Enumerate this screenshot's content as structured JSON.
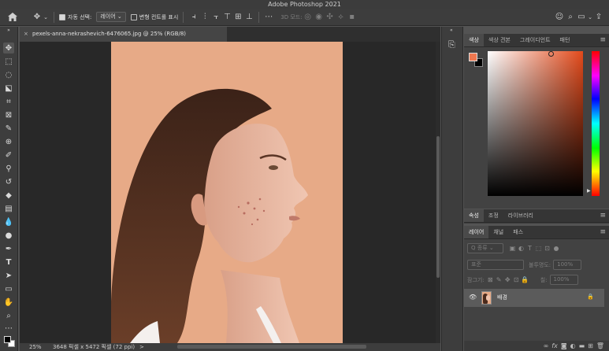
{
  "app": {
    "title": "Adobe Photoshop 2021"
  },
  "options": {
    "auto_select_label": "자동 선택:",
    "auto_select_value": "레이어",
    "transform_controls_label": "변형 컨트롤 표시",
    "mode_3d_label": "3D 모드:"
  },
  "document": {
    "tab_title": "pexels-anna-nekrashevich-6476065.jpg @ 25% (RGB/8)",
    "close_glyph": "×"
  },
  "status": {
    "zoom": "25%",
    "doc_info": "3648 픽셀 x 5472 픽셀 (72 ppi)",
    "arrow": ">"
  },
  "color_panel": {
    "tabs": [
      "색상",
      "색상 견본",
      "그레이디언트",
      "패턴"
    ],
    "foreground_color": "#f07850",
    "background_color": "#000000",
    "hue_color": "#e34a1b"
  },
  "properties_panel": {
    "tabs": [
      "속성",
      "조정",
      "라이브러리"
    ]
  },
  "layers_panel": {
    "tabs": [
      "레이어",
      "채널",
      "패스"
    ],
    "filter_kind": "Q 종류",
    "blend_mode": "표준",
    "opacity_label": "불투명도:",
    "opacity_value": "100%",
    "lock_label": "잠그기:",
    "fill_label": "칠:",
    "fill_value": "100%",
    "layers": [
      {
        "name": "배경",
        "visible": true,
        "locked": true
      }
    ]
  },
  "icons": {
    "home": "home-icon",
    "move": "move-icon",
    "search": "search-icon",
    "share": "share-icon",
    "eye": "eye-icon",
    "lock": "lock-icon"
  }
}
